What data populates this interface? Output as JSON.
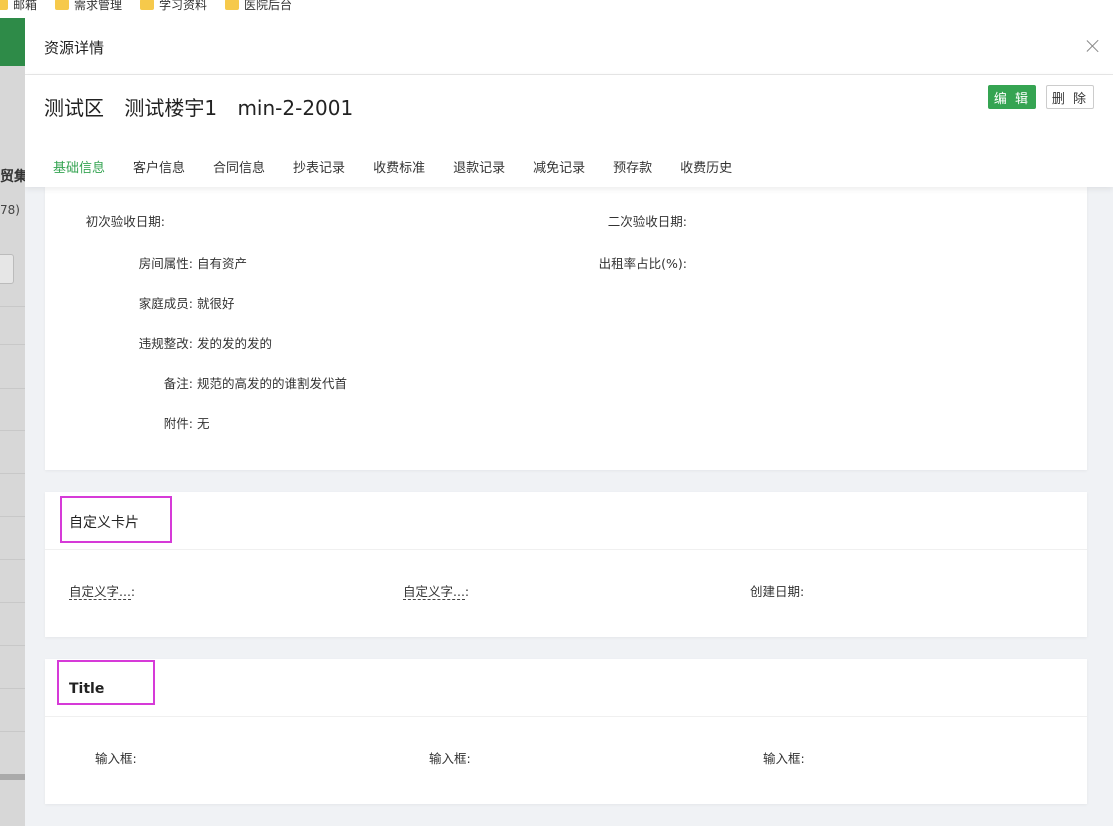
{
  "bookmarks": [
    "邮箱",
    "需求管理",
    "学习资料",
    "医院后台"
  ],
  "background": {
    "text1": "贸集",
    "text2": "78)"
  },
  "drawer": {
    "title": "资源详情",
    "resource_title": [
      "测试区",
      "测试楼宇1",
      "min-2-2001"
    ],
    "edit_label": "编 辑",
    "delete_label": "删 除",
    "tabs": [
      "基础信息",
      "客户信息",
      "合同信息",
      "抄表记录",
      "收费标准",
      "退款记录",
      "减免记录",
      "预存款",
      "收费历史"
    ],
    "active_tab": "基础信息"
  },
  "basic_info": {
    "first_inspect_label": "初次验收日期:",
    "first_inspect_value": "",
    "second_inspect_label": "二次验收日期:",
    "second_inspect_value": "",
    "property_label": "房间属性:",
    "property_value": "自有资产",
    "rent_ratio_label": "出租率占比(%):",
    "rent_ratio_value": "",
    "family_label": "家庭成员:",
    "family_value": "就很好",
    "violation_label": "违规整改:",
    "violation_value": "发的发的发的",
    "remark_label": "备注:",
    "remark_value": "规范的高发的的谁割发代首",
    "attachment_label": "附件:",
    "attachment_value": "无"
  },
  "custom_card": {
    "title": "自定义卡片",
    "field1_label": "自定义字...",
    "field2_label": "自定义字...",
    "colon": ":",
    "created_label": "创建日期:"
  },
  "title_card": {
    "title": "Title",
    "input1_label": "输入框:",
    "input2_label": "输入框:",
    "input3_label": "输入框:"
  },
  "colors": {
    "accent": "#35a452",
    "highlight": "#d63ad8"
  }
}
